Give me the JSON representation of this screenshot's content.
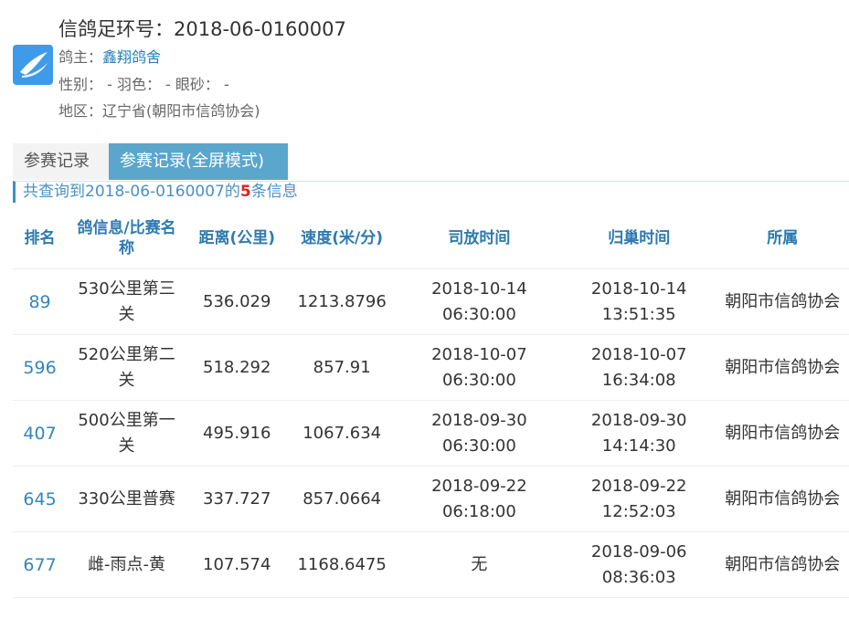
{
  "header": {
    "title": "信鸽足环号：2018-06-0160007",
    "owner_label": "鸽主：",
    "owner_value": "鑫翔鸽舍",
    "gender_line": "性别：  -  羽色：  -  眼砂：  -",
    "region_label": "地区：",
    "region_value": "辽宁省(朝阳市信鸽协会)",
    "logo_icon": "pigeon-logo-icon"
  },
  "tabs": [
    {
      "label": "参赛记录",
      "active": false
    },
    {
      "label": "参赛记录(全屏模式)",
      "active": true
    }
  ],
  "summary": {
    "prefix": "共查询到2018-06-0160007的",
    "count": "5",
    "suffix": "条信息"
  },
  "table": {
    "headers": [
      "排名",
      "鸽信息/比赛名称",
      "距离(公里)",
      "速度(米/分)",
      "司放时间",
      "归巢时间",
      "所属"
    ],
    "rows": [
      {
        "rank": "89",
        "race": "530公里第三关",
        "distance": "536.029",
        "speed": "1213.8796",
        "release_date": "2018-10-14",
        "release_time": "06:30:00",
        "return_date": "2018-10-14",
        "return_time": "13:51:35",
        "org": "朝阳市信鸽协会"
      },
      {
        "rank": "596",
        "race": "520公里第二关",
        "distance": "518.292",
        "speed": "857.91",
        "release_date": "2018-10-07",
        "release_time": "06:30:00",
        "return_date": "2018-10-07",
        "return_time": "16:34:08",
        "org": "朝阳市信鸽协会"
      },
      {
        "rank": "407",
        "race": "500公里第一关",
        "distance": "495.916",
        "speed": "1067.634",
        "release_date": "2018-09-30",
        "release_time": "06:30:00",
        "return_date": "2018-09-30",
        "return_time": "14:14:30",
        "org": "朝阳市信鸽协会"
      },
      {
        "rank": "645",
        "race": "330公里普赛",
        "distance": "337.727",
        "speed": "857.0664",
        "release_date": "2018-09-22",
        "release_time": "06:18:00",
        "return_date": "2018-09-22",
        "return_time": "12:52:03",
        "org": "朝阳市信鸽协会"
      },
      {
        "rank": "677",
        "race": "雌-雨点-黄",
        "distance": "107.574",
        "speed": "1168.6475",
        "release_date": "无",
        "release_time": "",
        "return_date": "2018-09-06",
        "return_time": "08:36:03",
        "org": "朝阳市信鸽协会"
      }
    ]
  }
}
